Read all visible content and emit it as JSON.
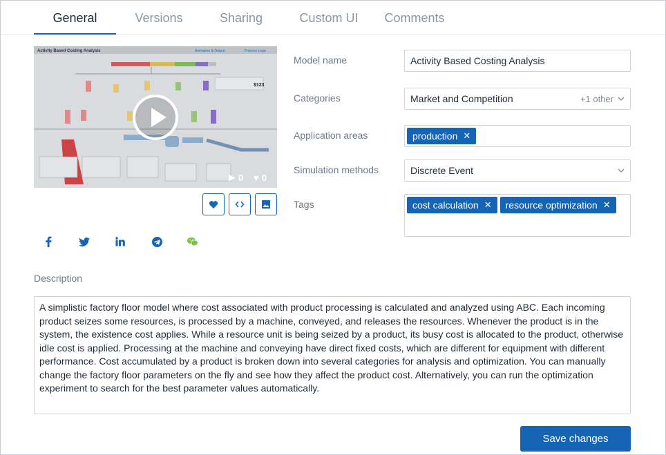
{
  "tabs": [
    {
      "label": "General",
      "active": true
    },
    {
      "label": "Versions"
    },
    {
      "label": "Sharing"
    },
    {
      "label": "Custom UI"
    },
    {
      "label": "Comments"
    }
  ],
  "preview": {
    "thumbnail_title": "Activity Based Costing Analysis",
    "thumbnail_links": [
      "Animation & Output",
      "Process Logic"
    ],
    "runs": "0",
    "likes": "0"
  },
  "actions": {
    "like_icon": "heart-icon",
    "embed_icon": "code-icon",
    "image_icon": "image-icon"
  },
  "share": [
    "facebook-icon",
    "twitter-icon",
    "linkedin-icon",
    "telegram-icon",
    "wechat-icon"
  ],
  "form": {
    "model_name_label": "Model name",
    "model_name_value": "Activity Based Costing Analysis",
    "categories_label": "Categories",
    "categories_value": "Market and Competition",
    "categories_more": "+1 other",
    "application_areas_label": "Application areas",
    "application_areas_chips": [
      "production"
    ],
    "simulation_methods_label": "Simulation methods",
    "simulation_methods_value": "Discrete Event",
    "tags_label": "Tags",
    "tags_chips": [
      "cost calculation",
      "resource optimization"
    ]
  },
  "description": {
    "label": "Description",
    "text": "A simplistic factory floor model where cost associated with product processing is calculated and analyzed using ABC. Each incoming product seizes some resources, is processed by a machine, conveyed, and releases the resources. Whenever the product is in the system, the existence cost applies. While a resource unit is being seized by a product, its busy cost is allocated to the product, otherwise idle cost is applied. Processing at the machine and conveying have direct fixed costs, which are different for equipment with different performance.  Cost accumulated by a product is broken down into several categories for analysis and optimization. You can manually change the factory floor parameters on the fly and see how they affect the product cost. Alternatively, you can run the optimization experiment to search for the best parameter values automatically."
  },
  "save_label": "Save changes",
  "colors": {
    "accent": "#1665b5",
    "muted": "#8a96a3"
  }
}
